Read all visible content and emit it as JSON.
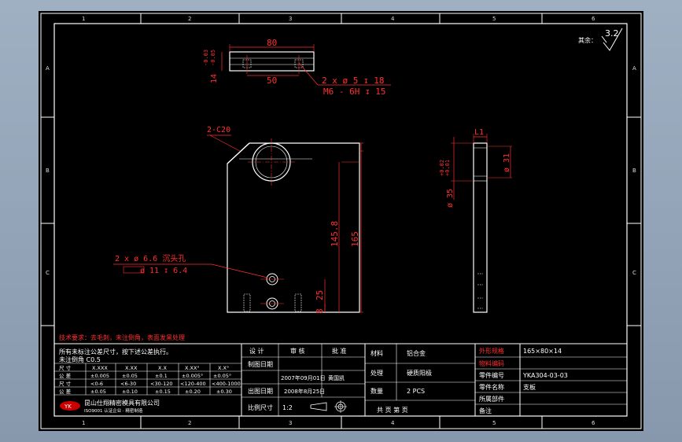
{
  "zone_columns": [
    "1",
    "2",
    "3",
    "4",
    "5",
    "6"
  ],
  "zone_rows": [
    "A",
    "B",
    "C"
  ],
  "roughness": {
    "label": "其余：",
    "value": "3.2"
  },
  "top_view": {
    "overall_width": "80",
    "hole_spacing": "50",
    "height": "14",
    "tol_upper": "-0.03",
    "tol_lower": "-0.05",
    "callout_line1": "2 x ø 5 ↧ 18",
    "callout_line2": "M6 - 6H ↧ 15"
  },
  "front_view": {
    "chamfer": "2-C20",
    "height_total": "165",
    "bore_center_height": "145.8",
    "hole_height_1": "25",
    "hole_height_2": "8",
    "hole_callout_line1": "2 x ø  6.6 沉头孔",
    "hole_callout_line2": "ø 11 ↧ 6.4"
  },
  "side_view": {
    "width": "L1",
    "bore_diameter": "ø 31",
    "outer_diameter": "ø 35",
    "od_tol_upper": "+0.02",
    "od_tol_lower": "+0.01"
  },
  "notes": {
    "red_note": "技术要求：去毛刺，未注倒角，表面发黑处理",
    "line1": "所有未标注公差尺寸，按下述公差执行。",
    "line2": "未注倒角 C0.5"
  },
  "tolerance_table": {
    "header": [
      "尺 寸",
      "X.XXX",
      "X.XX",
      "X.X",
      "X.XX°",
      "X.X°"
    ],
    "rows": [
      [
        "公 差",
        "±0.005",
        "±0.05",
        "±0.1",
        "±0.005°",
        "±0.05°"
      ],
      [
        "尺 寸",
        "<0-6",
        "<6-30",
        "<30-120",
        "<120-400",
        "<400-1000"
      ],
      [
        "公 差",
        "±0.05",
        "±0.10",
        "±0.15",
        "±0.20",
        "±0.30"
      ]
    ]
  },
  "title_block": {
    "design_label": "设 计",
    "review_label": "审 核",
    "approve_label": "批 准",
    "drawing_date_label": "制图日期",
    "drawing_date": "2007年09月01日",
    "drawer": "黄国凯",
    "print_date_label": "出图日期",
    "print_date": "2008年8月25日",
    "scale_label": "比例尺寸",
    "scale": "1:2",
    "material_label": "材料",
    "material": "铝合金",
    "process_label": "处理",
    "process": "硬质阳极",
    "qty_label": "数量",
    "qty": "2 PCS",
    "sheet_label": "共 页 第 页",
    "spec_label": "外形规格",
    "spec": "165×80×14",
    "mat_no_label": "物料编码",
    "drawing_no_label": "零件编号",
    "drawing_no": "YKA304-03-03",
    "part_name_label": "零件名称",
    "part_name": "支板",
    "assembly_label": "所属部件",
    "remark_label": "备注",
    "company_name": "昆山仕翔精密模具有限公司",
    "company_sub": "ISO9001 认证企业 · 精密制造",
    "logo_text": "YK"
  }
}
